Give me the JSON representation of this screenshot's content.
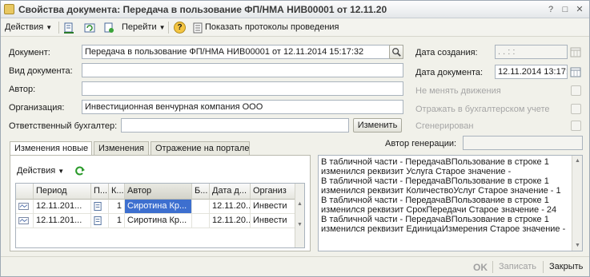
{
  "window": {
    "title": "Свойства документа: Передача в пользование ФП/НМА НИВ00001 от 12.11.20"
  },
  "toolbar": {
    "actions_label": "Действия",
    "goto_label": "Перейти",
    "show_protocols_label": "Показать протоколы проведения"
  },
  "form": {
    "document_label": "Документ:",
    "document_value": "Передача в пользование ФП/НМА НИВ00001 от 12.11.2014 15:17:32",
    "doc_type_label": "Вид документа:",
    "doc_type_value": "",
    "author_label": "Автор:",
    "author_value": "",
    "org_label": "Организация:",
    "org_value": "Инвестиционная венчурная компания ООО",
    "accountant_label": "Ответственный бухгалтер:",
    "accountant_value": "",
    "change_button": "Изменить",
    "created_label": "Дата создания:",
    "created_value": ".  .     :  :",
    "doc_date_label": "Дата документа:",
    "doc_date_value": "12.11.2014 13:17:",
    "no_change_label": "Не менять движения",
    "reflect_label": "Отражать в бухгалтерском учете",
    "generated_label": "Сгенерирован",
    "gen_author_label": "Автор генерации:",
    "gen_author_value": ""
  },
  "tabs": [
    {
      "label": "Изменения новые"
    },
    {
      "label": "Изменения"
    },
    {
      "label": "Отражение на портале"
    }
  ],
  "panel": {
    "actions_label": "Действия"
  },
  "grid": {
    "headers": [
      "",
      "Период",
      "П...",
      "К...",
      "Автор",
      "Б...",
      "Дата д...",
      "Организ"
    ],
    "rows": [
      [
        "",
        "12.11.201...",
        "",
        "1",
        "Сиротина Кр...",
        "",
        "12.11.20...",
        "Инвести"
      ],
      [
        "",
        "12.11.201...",
        "",
        "1",
        "Сиротина Кр...",
        "",
        "12.11.20...",
        "Инвести"
      ]
    ]
  },
  "log": {
    "lines": [
      "В табличной части  -  ПередачаВПользование в строке 1",
      "изменился реквизит Услуга Старое значение -",
      "В табличной части  -  ПередачаВПользование в строке 1",
      "изменился реквизит КоличествоУслуг Старое значение - 1",
      "В табличной части  -  ПередачаВПользование в строке 1",
      "изменился реквизит СрокПередачи Старое значение - 24",
      "В табличной части  -  ПередачаВПользование в строке 1",
      "изменился реквизит ЕдиницаИзмерения Старое значение -"
    ]
  },
  "footer": {
    "ok_label": "OK",
    "save_label": "Записать",
    "close_label": "Закрыть"
  }
}
